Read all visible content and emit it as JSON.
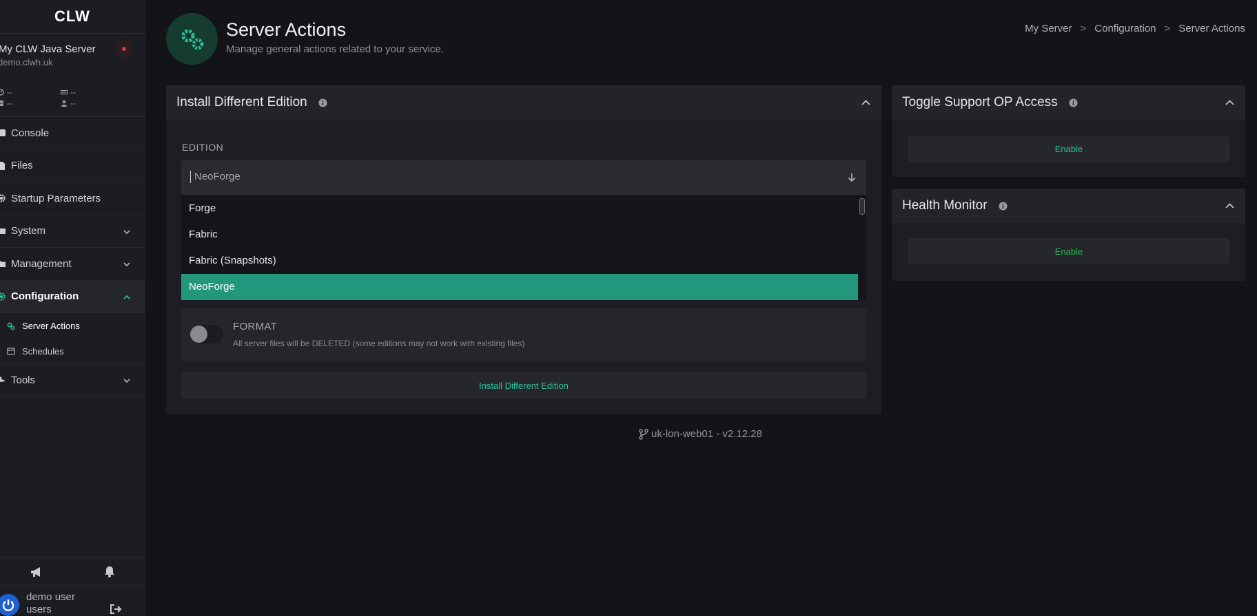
{
  "sidebar": {
    "logo": "CLW",
    "server_name": "My CLW Java Server",
    "server_host": "demo.clwh.uk",
    "stats": [
      "--",
      "--",
      "--",
      "--"
    ],
    "nav": {
      "console": "Console",
      "files": "Files",
      "startup": "Startup Parameters",
      "system": "System",
      "management": "Management",
      "configuration": "Configuration",
      "server_actions": "Server Actions",
      "schedules": "Schedules",
      "tools": "Tools"
    },
    "user": {
      "name_line1": "demo user",
      "name_line2": "users"
    }
  },
  "header": {
    "title": "Server Actions",
    "subtitle": "Manage general actions related to your service.",
    "breadcrumb": [
      "My Server",
      "Configuration",
      "Server Actions"
    ],
    "separator": ">"
  },
  "install_card": {
    "title": "Install Different Edition",
    "edition_label": "EDITION",
    "selected": "NeoForge",
    "options": [
      "Forge",
      "Fabric",
      "Fabric (Snapshots)",
      "NeoForge"
    ],
    "format_title": "FORMAT",
    "format_desc": "All server files will be DELETED (some editions may not work with existing files)",
    "button": "Install Different Edition"
  },
  "support_card": {
    "title": "Toggle Support OP Access",
    "button": "Enable"
  },
  "health_card": {
    "title": "Health Monitor",
    "button": "Enable"
  },
  "footer": {
    "version": "uk-lon-web01 - v2.12.28"
  },
  "colors": {
    "accent": "#23977b",
    "accent_text": "#2bc19a",
    "health_text": "#29b84e",
    "status": "#d63a48"
  }
}
